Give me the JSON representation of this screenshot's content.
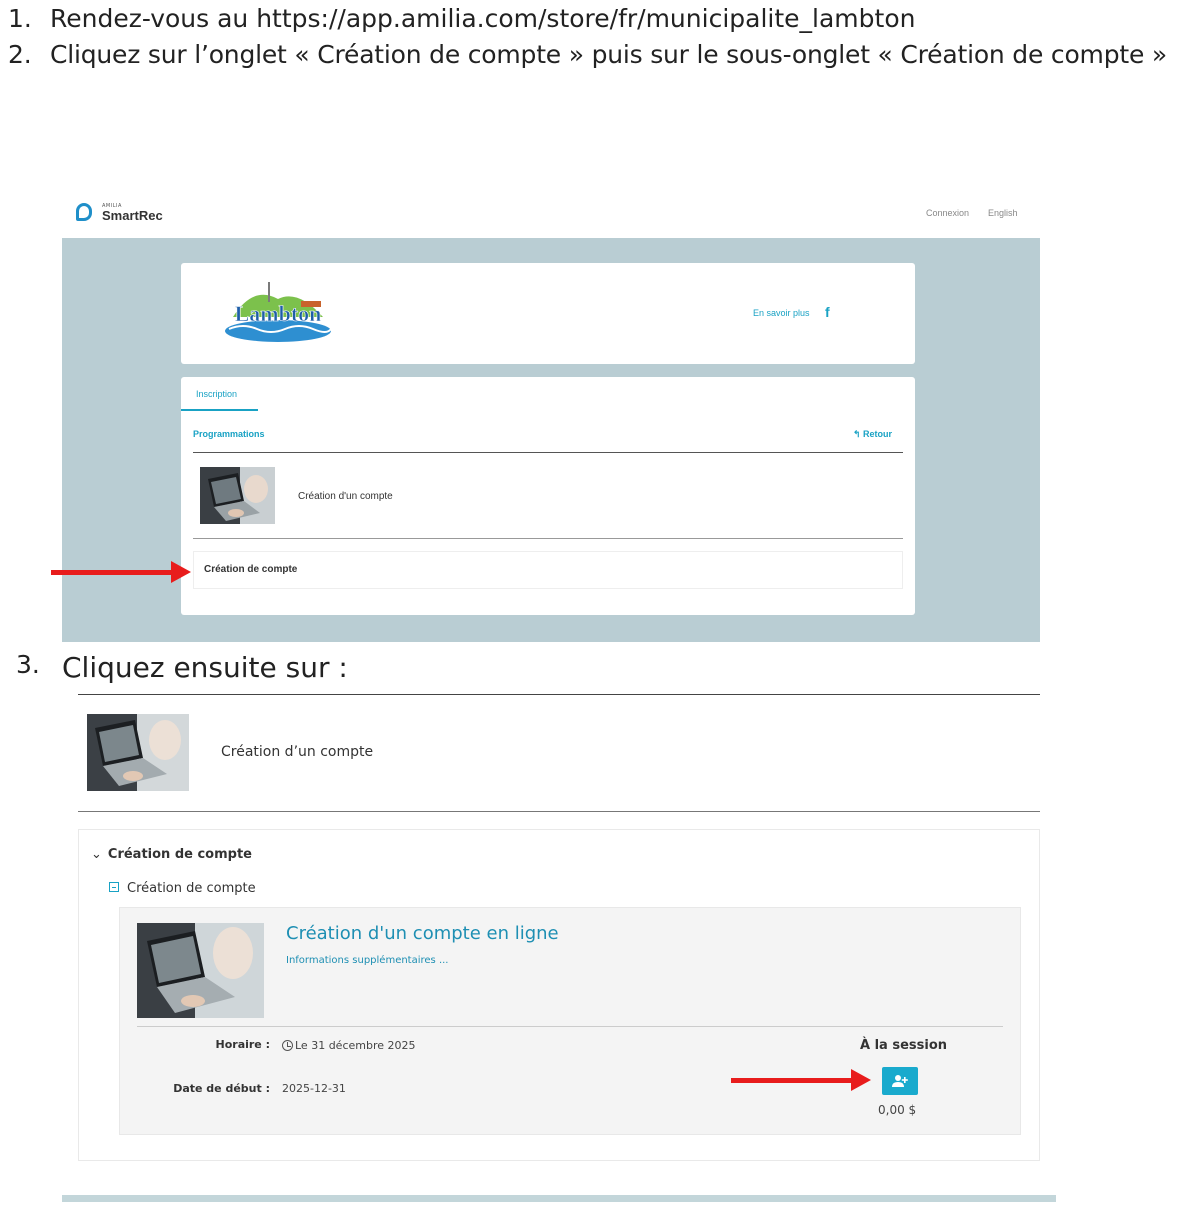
{
  "steps": {
    "step1_num": "1.",
    "step1_text": "Rendez-vous au https://app.amilia.com/store/fr/municipalite_lambton",
    "step2_num": "2.",
    "step2_text": "Cliquez sur l’onglet « Création de compte » puis sur le sous-onglet « Création de compte »",
    "step3_num": "3.",
    "step3_text": "Cliquez ensuite sur :"
  },
  "screenshot1": {
    "brand_small": "AMILIA",
    "brand": "SmartRec",
    "nav_login": "Connexion",
    "nav_language": "English",
    "org_name": "Lambton",
    "learn_more": "En savoir plus",
    "facebook_icon": "f",
    "tab_label": "Inscription",
    "programs_label": "Programmations",
    "back_label": "↰ Retour",
    "program_title": "Création d'un compte",
    "sub_item_label": "Création de compte"
  },
  "screenshot2": {
    "program_title": "Création d’un compte",
    "accordion_title": "Création de compte",
    "sub_category": "Création de compte",
    "activity_title": "Création d'un compte en ligne",
    "more_info": "Informations supplémentaires ...",
    "schedule_label": "Horaire :",
    "schedule_value": "Le 31 décembre 2025",
    "start_label": "Date de début :",
    "start_value": "2025-12-31",
    "session_label": "À la session",
    "price": "0,00 $"
  },
  "colors": {
    "accent": "#19a2c4",
    "arrow": "#e81c1c",
    "backdrop": "#b9cdd3"
  }
}
